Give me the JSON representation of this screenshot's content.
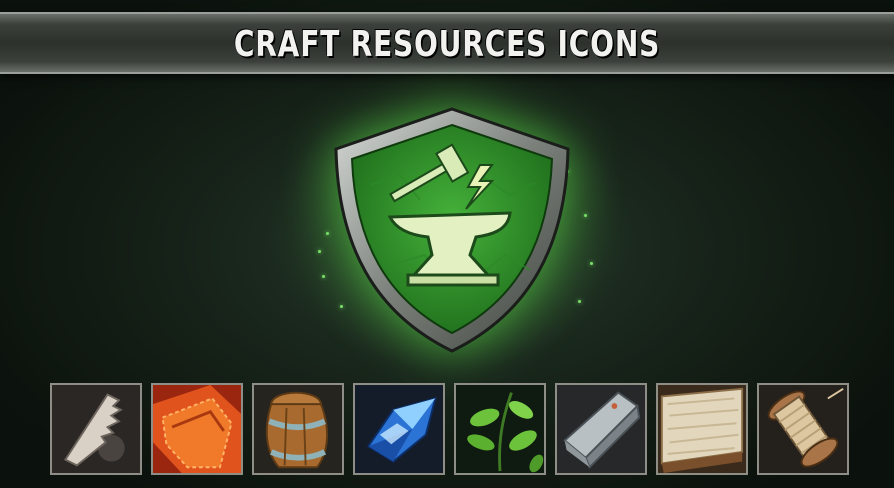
{
  "banner": {
    "title": "CRAFT RESOURCES ICONS"
  },
  "emblem": {
    "icon": "anvil-hammer-shield-icon",
    "glow_color": "#5cdc46"
  },
  "resources": [
    {
      "icon": "bone-saw-icon"
    },
    {
      "icon": "orange-leather-icon"
    },
    {
      "icon": "wooden-barrel-icon"
    },
    {
      "icon": "blue-crystal-icon"
    },
    {
      "icon": "herb-leaves-icon"
    },
    {
      "icon": "metal-ingot-icon"
    },
    {
      "icon": "fur-pelt-icon"
    },
    {
      "icon": "thread-spool-icon"
    }
  ]
}
